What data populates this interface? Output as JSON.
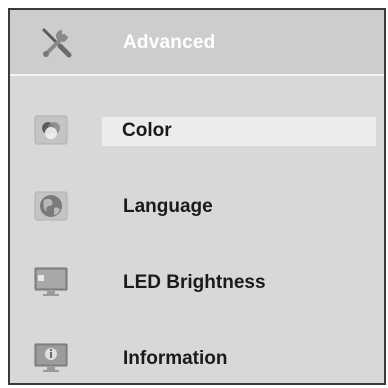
{
  "header": {
    "title": "Advanced",
    "icon": "tools-icon"
  },
  "menu": {
    "items": [
      {
        "label": "Color",
        "icon": "color-icon",
        "selected": true
      },
      {
        "label": "Language",
        "icon": "globe-icon",
        "selected": false
      },
      {
        "label": "LED Brightness",
        "icon": "monitor-brightness-icon",
        "selected": false
      },
      {
        "label": "Information",
        "icon": "info-monitor-icon",
        "selected": false
      }
    ]
  },
  "colors": {
    "panel_background": "#d8d8d8",
    "header_background": "#cdcdcd",
    "highlight": "#ececec",
    "border": "#3a3a3a"
  }
}
